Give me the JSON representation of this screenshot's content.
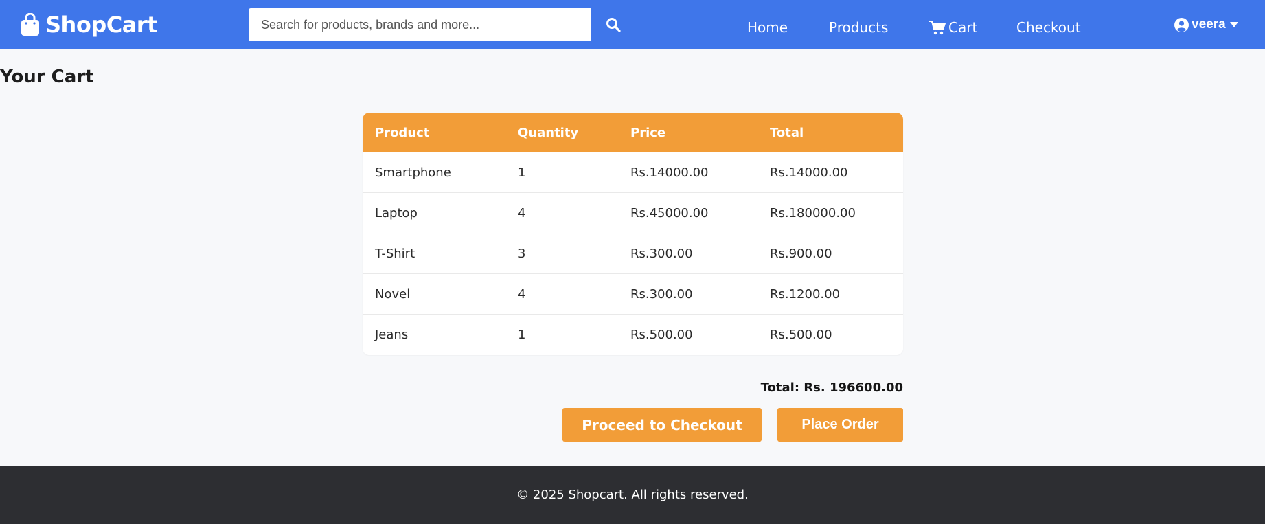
{
  "header": {
    "brand": "ShopCart",
    "search": {
      "placeholder": "Search for products, brands and more...",
      "value": ""
    },
    "nav": {
      "home": "Home",
      "products": "Products",
      "cart": "Cart",
      "checkout": "Checkout"
    },
    "user": "veera",
    "icons": {
      "brand": "shopping-bag-icon",
      "search": "search-icon",
      "cart": "cart-icon",
      "user": "user-circle-icon",
      "caret": "caret-down-icon"
    }
  },
  "page": {
    "title": "Your Cart"
  },
  "table": {
    "headers": {
      "product": "Product",
      "quantity": "Quantity",
      "price": "Price",
      "total": "Total"
    },
    "rows": [
      {
        "product": "Smartphone",
        "quantity": "1",
        "price": "Rs.14000.00",
        "total": "Rs.14000.00"
      },
      {
        "product": "Laptop",
        "quantity": "4",
        "price": "Rs.45000.00",
        "total": "Rs.180000.00"
      },
      {
        "product": "T-Shirt",
        "quantity": "3",
        "price": "Rs.300.00",
        "total": "Rs.900.00"
      },
      {
        "product": "Novel",
        "quantity": "4",
        "price": "Rs.300.00",
        "total": "Rs.1200.00"
      },
      {
        "product": "Jeans",
        "quantity": "1",
        "price": "Rs.500.00",
        "total": "Rs.500.00"
      }
    ]
  },
  "summary": {
    "total": "Total: Rs. 196600.00",
    "checkout_button": "Proceed to Checkout",
    "place_order_button": "Place Order"
  },
  "footer": {
    "text": "© 2025 Shopcart. All rights reserved."
  },
  "colors": {
    "navbar": "#3f76ea",
    "accent": "#f29d38",
    "footer": "#2d2e32",
    "background": "#f7f8fa"
  }
}
